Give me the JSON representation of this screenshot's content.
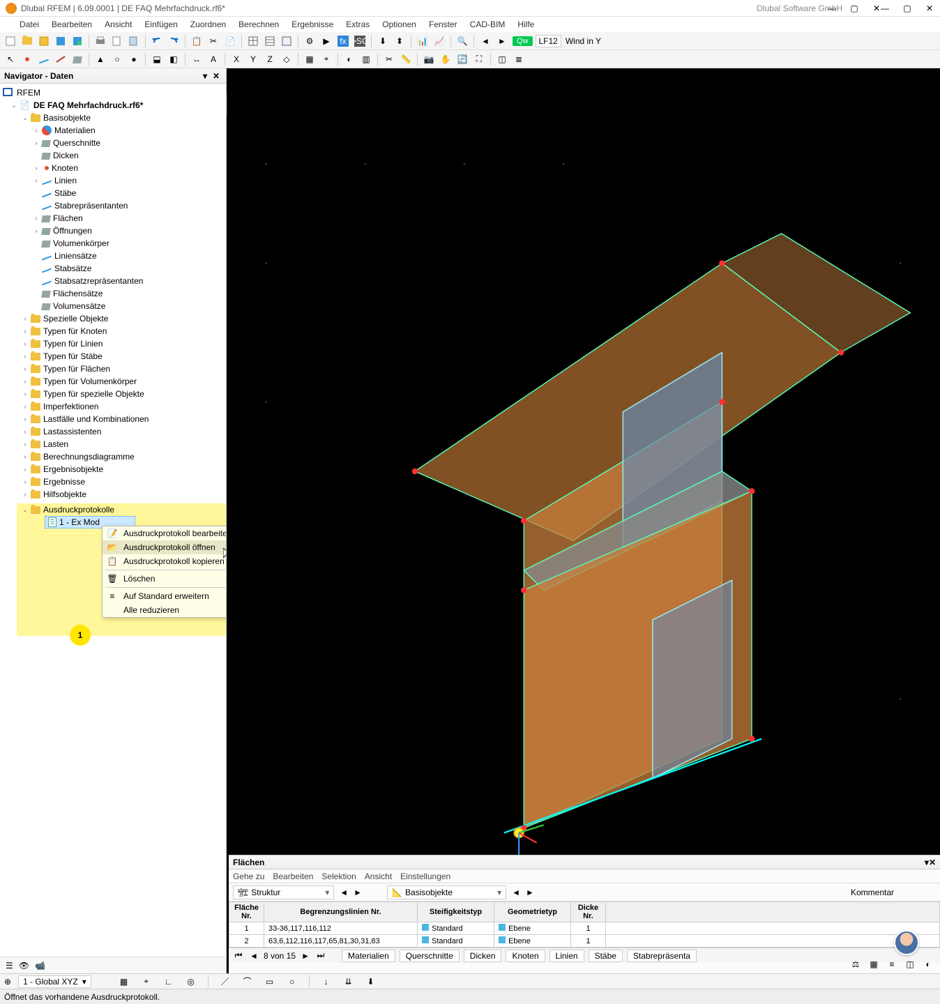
{
  "titlebar": {
    "title": "Dlubal RFEM | 6.09.0001 | DE FAQ Mehrfachdruck.rf6*",
    "company": "Dlubal Software GmbH"
  },
  "menu": [
    "Datei",
    "Bearbeiten",
    "Ansicht",
    "Einfügen",
    "Zuordnen",
    "Berechnen",
    "Ergebnisse",
    "Extras",
    "Optionen",
    "Fenster",
    "CAD-BIM",
    "Hilfe"
  ],
  "loadcase_badges": {
    "qw": "Qw",
    "lf": "LF12",
    "desc": "Wind in Y"
  },
  "navigator": {
    "title": "Navigator - Daten",
    "root": "RFEM",
    "model": "DE FAQ Mehrfachdruck.rf6*",
    "basis": "Basisobjekte",
    "basis_children": [
      "Materialien",
      "Querschnitte",
      "Dicken",
      "Knoten",
      "Linien",
      "Stäbe",
      "Stabrepräsentanten",
      "Flächen",
      "Öffnungen",
      "Volumenkörper",
      "Liniensätze",
      "Stabsätze",
      "Stabsatzrepräsentanten",
      "Flächensätze",
      "Volumensätze"
    ],
    "top_level": [
      "Spezielle Objekte",
      "Typen für Knoten",
      "Typen für Linien",
      "Typen für Stäbe",
      "Typen für Flächen",
      "Typen für Volumenkörper",
      "Typen für spezielle Objekte",
      "Imperfektionen",
      "Lastfälle und Kombinationen",
      "Lastassistenten",
      "Lasten",
      "Berechnungsdiagramme",
      "Ergebnisobjekte",
      "Ergebnisse",
      "Hilfsobjekte"
    ],
    "printouts": "Ausdruckprotokolle",
    "printout_child": "1 - Ex Mod"
  },
  "context_menu": {
    "items": [
      "Ausdruckprotokoll bearbeiten",
      "Ausdruckprotokoll öffnen",
      "Ausdruckprotokoll kopieren",
      "Löschen",
      "Auf Standard erweitern",
      "Alle reduzieren"
    ]
  },
  "callout": "1",
  "flaechen_panel": {
    "title": "Flächen",
    "submenu": [
      "Gehe zu",
      "Bearbeiten",
      "Selektion",
      "Ansicht",
      "Einstellungen"
    ],
    "sel1": "Struktur",
    "sel2": "Basisobjekte",
    "headers": [
      "Fläche Nr.",
      "Begrenzungslinien Nr.",
      "Steifigkeitstyp",
      "Geometrietyp",
      "Dicke Nr."
    ],
    "rows": [
      {
        "nr": "1",
        "lines": "33-36,117,116,112",
        "stiff": "Standard",
        "geom": "Ebene",
        "thick": "1"
      },
      {
        "nr": "2",
        "lines": "63,6,112,116,117,65,81,30,31,83",
        "stiff": "Standard",
        "geom": "Ebene",
        "thick": "1"
      }
    ],
    "nav_text": "8 von 15",
    "tabs": [
      "Materialien",
      "Querschnitte",
      "Dicken",
      "Knoten",
      "Linien",
      "Stäbe",
      "Stabrepräsenta"
    ],
    "kommentar": "Kommentar"
  },
  "statusbar": {
    "coords": "1 - Global XYZ",
    "hint": "Öffnet das vorhandene Ausdruckprotokoll."
  }
}
